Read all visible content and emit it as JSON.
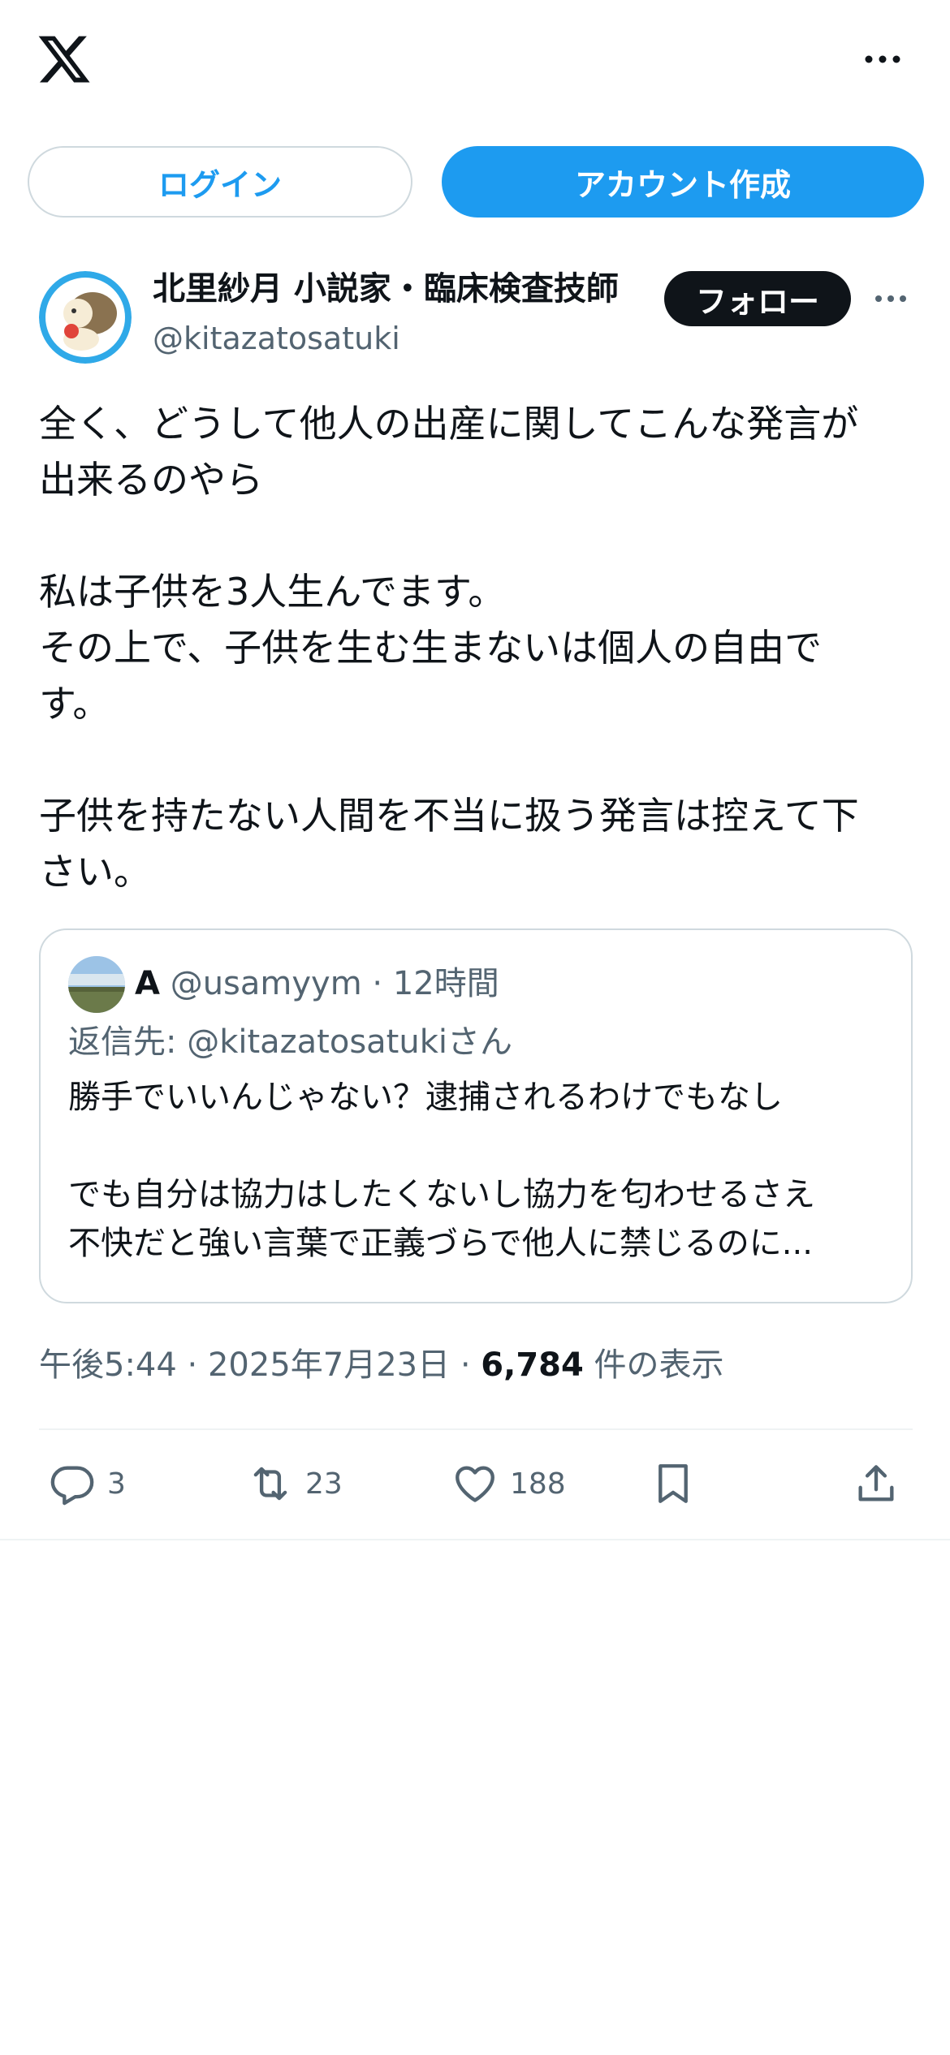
{
  "header": {
    "logo_icon": "x-logo-icon",
    "more_icon": "more-horizontal-icon",
    "login_label": "ログイン",
    "signup_label": "アカウント作成"
  },
  "author": {
    "name": "北里紗月 小説家・臨床検査技師",
    "handle": "@kitazatosatuki",
    "follow_label": "フォロー"
  },
  "post": {
    "text": "全く、どうして他人の出産に関してこんな発言が\n出来るのやら\n\n私は子供を3人生んでます。\nその上で、子供を生む生まないは個人の自由で\nす。\n\n子供を持たない人間を不当に扱う発言は控えて下\nさい。"
  },
  "quote": {
    "name": "A",
    "handle": "@usamyym",
    "sep": "·",
    "time": "12時間",
    "reply_to": "返信先: @kitazatosatukiさん",
    "text": "勝手でいいんじゃない？逮捕されるわけでもなし\n\nでも自分は協力はしたくないし協力を匂わせるさえ\n不快だと強い言葉で正義づらで他人に禁じるのに..."
  },
  "meta": {
    "time": "午後5:44",
    "sep1": "·",
    "date": "2025年7月23日",
    "sep2": "·",
    "views": "6,784",
    "views_label": "件の表示"
  },
  "actions": {
    "reply_count": "3",
    "retweet_count": "23",
    "like_count": "188"
  },
  "colors": {
    "accent": "#1d9bf0",
    "text": "#0f1419",
    "secondary": "#536471",
    "border": "#cfd9de"
  }
}
